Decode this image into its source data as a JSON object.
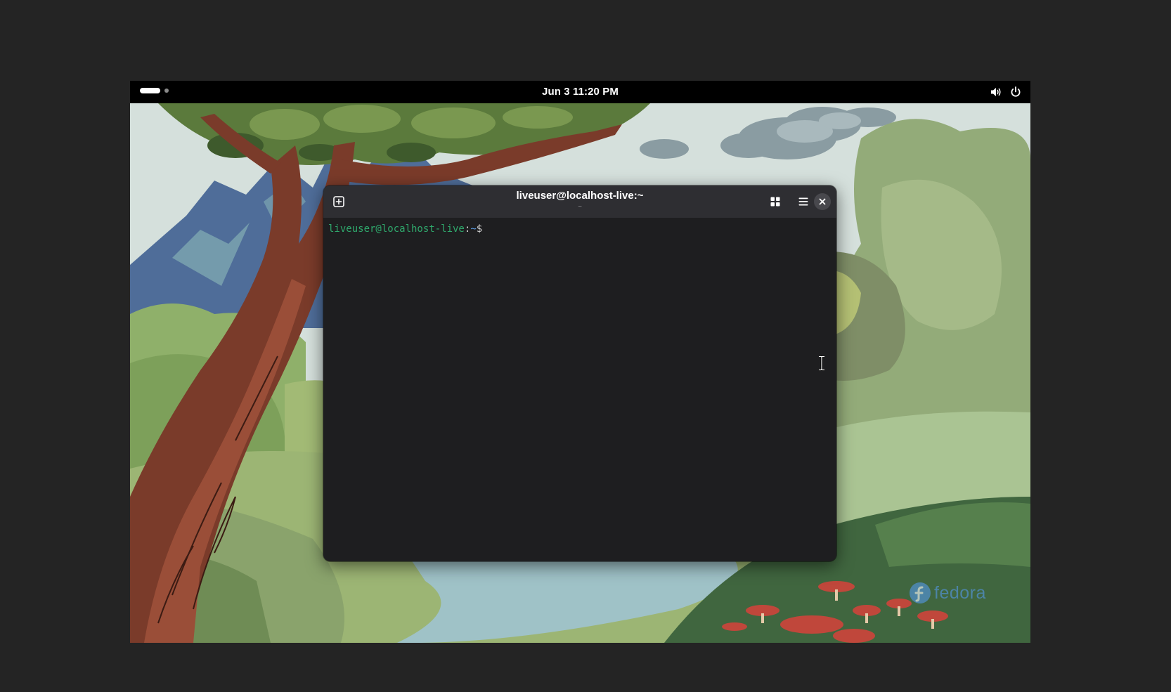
{
  "topbar": {
    "clock": "Jun 3  11:20 PM",
    "icons": [
      "workspace-indicator",
      "volume-icon",
      "power-icon"
    ]
  },
  "terminal": {
    "title": "liveuser@localhost-live:~",
    "subtitle": "~",
    "prompt": {
      "user_host": "liveuser@localhost-live",
      "separator": ":",
      "path": "~",
      "symbol": "$"
    },
    "buttons": [
      "new-tab-icon",
      "grid-view-icon",
      "hamburger-menu-icon",
      "close-icon"
    ]
  },
  "wallpaper": {
    "brand": "fedora"
  },
  "colors": {
    "prompt_user": "#2fa86c",
    "prompt_path": "#5d9ee3",
    "terminal_bg": "#1e1e20",
    "headerbar_bg": "#2e2e32",
    "topbar_bg": "#000000"
  }
}
